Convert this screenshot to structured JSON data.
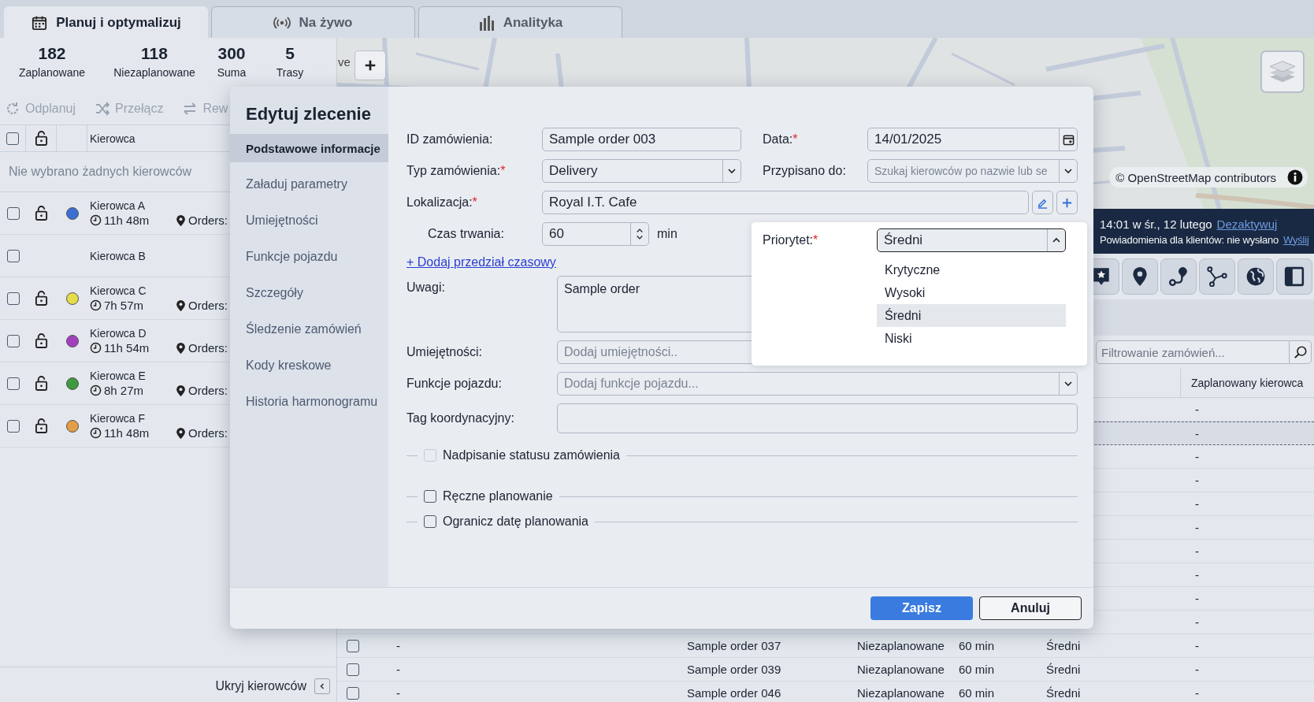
{
  "tabs": [
    {
      "label": "Planuj i optymalizuj",
      "selected": true
    },
    {
      "label": "Na żywo",
      "selected": false
    },
    {
      "label": "Analityka",
      "selected": false
    }
  ],
  "drivers_panel": {
    "stats": [
      {
        "value": "182",
        "label": "Zaplanowane"
      },
      {
        "value": "118",
        "label": "Niezaplanowane"
      },
      {
        "value": "300",
        "label": "Suma"
      },
      {
        "value": "5",
        "label": "Trasy"
      }
    ],
    "toolbar": [
      {
        "label": "Odplanuj",
        "disabled": true
      },
      {
        "label": "Przełącz",
        "disabled": true
      },
      {
        "label": "Rew",
        "disabled": true
      }
    ],
    "header": {
      "checked": false,
      "column": "Kierowca"
    },
    "empty_message": "Nie wybrano żadnych kierowców",
    "drivers": [
      {
        "name": "Kierowca A",
        "checked": false,
        "color": "#3b6fd4",
        "time": "11h 48m",
        "orders_label": "Orders:"
      },
      {
        "name": "Kierowca B",
        "checked": false
      },
      {
        "name": "Kierowca C",
        "checked": false,
        "color": "#e6dc4a",
        "time": "7h 57m",
        "orders_label": "Orders:"
      },
      {
        "name": "Kierowca D",
        "checked": false,
        "color": "#a23fbf",
        "time": "11h 54m",
        "orders_label": "Orders:"
      },
      {
        "name": "Kierowca E",
        "checked": false,
        "color": "#3f9a3f",
        "time": "8h 27m",
        "orders_label": "Orders:"
      },
      {
        "name": "Kierowca F",
        "checked": false,
        "color": "#e39d45",
        "time": "11h 48m",
        "orders_label": "Orders:"
      }
    ],
    "hide_label": "Ukryj kierowców"
  },
  "map": {
    "side_label": "ve",
    "attribution": "© OpenStreetMap contributors"
  },
  "notice": {
    "line_1": "14:01 w śr., 12 lutego",
    "link_1": "Dezaktywuj",
    "line_2": "Powiadomienia dla klientów: nie wysłano",
    "link_2": "Wyślij"
  },
  "orders": {
    "filter_placeholder": "Filtrowanie zamówień...",
    "header_scheduled_driver": "Zaplanowany kierowca",
    "rows": [
      {
        "selected": false,
        "cells": {
          "scheduled_driver": "-"
        }
      },
      {
        "selected": true,
        "cells": {
          "scheduled_driver": "-"
        }
      },
      {
        "selected": false,
        "cells": {
          "scheduled_driver": "-"
        }
      },
      {
        "selected": false,
        "cells": {
          "scheduled_driver": "-"
        }
      },
      {
        "selected": false,
        "cells": {
          "scheduled_driver": "-"
        }
      },
      {
        "selected": false,
        "cells": {
          "scheduled_driver": "-"
        }
      },
      {
        "selected": false,
        "cells": {
          "scheduled_driver": "-"
        }
      },
      {
        "selected": false,
        "cells": {
          "scheduled_driver": "-"
        }
      },
      {
        "selected": false,
        "cells": {
          "scheduled_driver": "-"
        }
      },
      {
        "selected": false,
        "cells": {
          "scheduled_driver": "-"
        }
      },
      {
        "checked": false,
        "selected": false,
        "cells": {
          "col_2": "-",
          "order_id": "Sample order 037",
          "status": "Niezaplanowane",
          "duration": "60 min",
          "priority": "Średni",
          "scheduled_driver": "-"
        }
      },
      {
        "checked": false,
        "selected": false,
        "cells": {
          "col_2": "-",
          "order_id": "Sample order 039",
          "status": "Niezaplanowane",
          "duration": "60 min",
          "priority": "Średni",
          "scheduled_driver": "-"
        }
      },
      {
        "checked": false,
        "selected": false,
        "cells": {
          "col_2": "-",
          "order_id": "Sample order 046",
          "status": "Niezaplanowane",
          "duration": "60 min",
          "priority": "Średni",
          "scheduled_driver": "-"
        }
      }
    ]
  },
  "edit_order": {
    "title": "Edytuj zlecenie",
    "sections": [
      {
        "label": "Podstawowe informacje",
        "selected": true
      },
      {
        "label": "Załaduj parametry",
        "selected": false
      },
      {
        "label": "Umiejętności",
        "selected": false
      },
      {
        "label": "Funkcje pojazdu",
        "selected": false
      },
      {
        "label": "Szczegóły",
        "selected": false
      },
      {
        "label": "Śledzenie zamówień",
        "selected": false
      },
      {
        "label": "Kody kreskowe",
        "selected": false
      },
      {
        "label": "Historia harmonogramu",
        "selected": false
      }
    ],
    "order_id": {
      "label": "ID zamówienia:",
      "value": "Sample order 003"
    },
    "date": {
      "label": "Data:",
      "mark": "*",
      "value": "14/01/2025"
    },
    "order_type": {
      "label": "Typ zamówienia:",
      "mark": "*",
      "value": "Delivery"
    },
    "assigned_to": {
      "label": "Przypisano do:",
      "placeholder": "Szukaj kierowców po nazwie lub se"
    },
    "location": {
      "label": "Lokalizacja:",
      "mark": "*",
      "value": "Royal I.T. Cafe"
    },
    "duration": {
      "label": "Czas trwania:",
      "value": "60",
      "unit": "min"
    },
    "priority": {
      "label": "Priorytet:",
      "mark": "*",
      "value": "Średni",
      "expanded": true,
      "options": [
        {
          "label": "Krytyczne",
          "selected": false
        },
        {
          "label": "Wysoki",
          "selected": false
        },
        {
          "label": "Średni",
          "selected": true
        },
        {
          "label": "Niski",
          "selected": false
        }
      ]
    },
    "add_time_window": "+ Dodaj przedział czasowy",
    "notes": {
      "label": "Uwagi:",
      "value": "Sample order"
    },
    "skills": {
      "label": "Umiejętności:",
      "placeholder": "Dodaj umiejętności.."
    },
    "vehicle_features": {
      "label": "Funkcje pojazdu:",
      "placeholder": "Dodaj funkcje pojazdu..."
    },
    "coordination_tag": {
      "label": "Tag koordynacyjny:"
    },
    "options": [
      {
        "label": "Nadpisanie statusu zamówienia",
        "checked": false,
        "disabled": true
      },
      {
        "label": "Ręczne planowanie",
        "checked": false,
        "disabled": false
      },
      {
        "label": "Ogranicz datę planowania",
        "checked": false,
        "disabled": false
      }
    ],
    "save_button": "Zapisz",
    "cancel_button": "Anuluj"
  }
}
